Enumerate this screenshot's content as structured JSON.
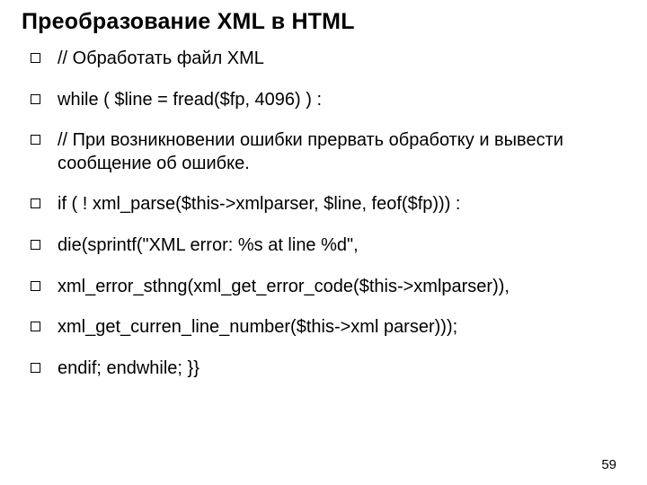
{
  "title": "Преобразование XML в HTML",
  "bullets": [
    "// Обработать файл XML",
    "while ( $line = fread($fp, 4096) ) :",
    "// При возникновении ошибки прервать обработку  и вывести сообщение об ошибке.",
    "if ( ! xml_parse($this->xmlparser, $line, feof($fp))) :",
    "die(sprintf(\"XML error: %s at line %d\",",
    "xml_error_sthng(xml_get_error_code($this->xmlparser)),",
    "xml_get_curren_line_number($this->xml parser)));",
    "endif; endwhile; }}"
  ],
  "page_number": "59"
}
